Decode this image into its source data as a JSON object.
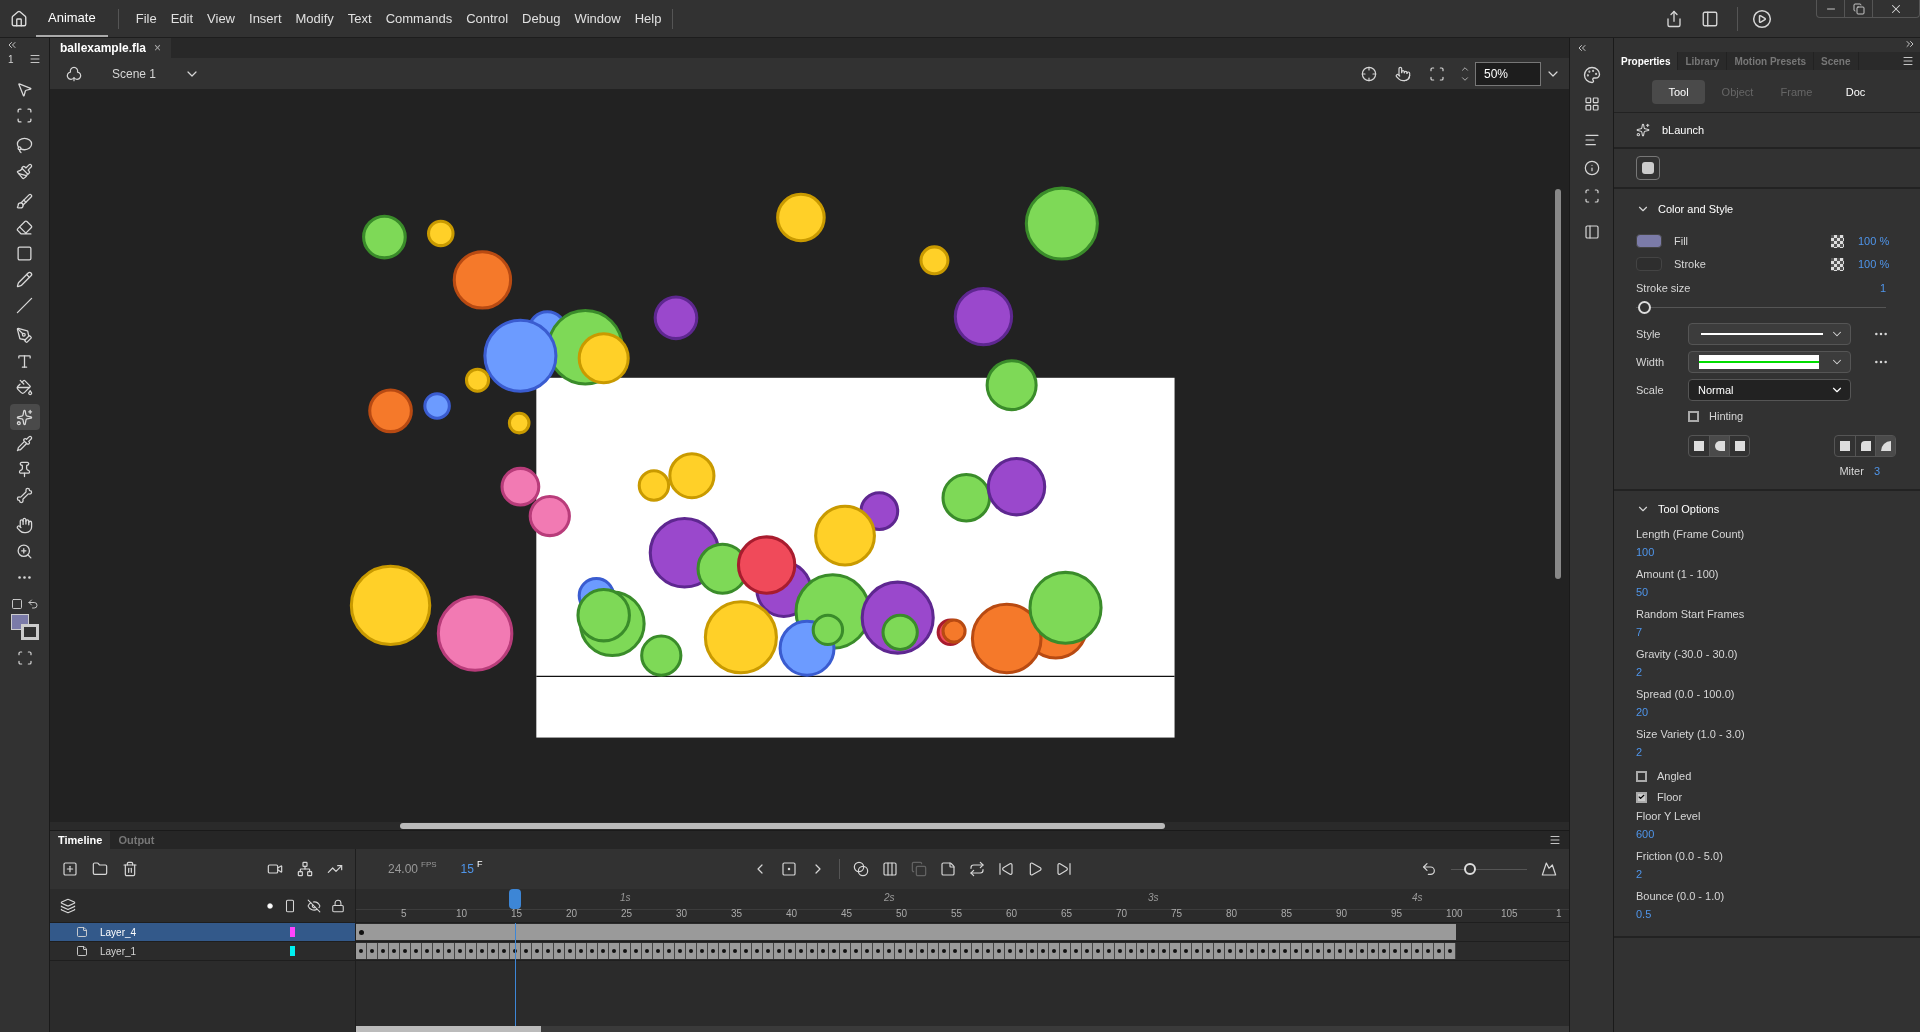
{
  "menu_bar": {
    "app_tab": "Animate",
    "menus": [
      "File",
      "Edit",
      "View",
      "Insert",
      "Modify",
      "Text",
      "Commands",
      "Control",
      "Debug",
      "Window",
      "Help"
    ]
  },
  "toolbar": {
    "workspace_number": "1",
    "tools": [
      {
        "kind": "select",
        "selected": false
      },
      {
        "kind": "subselect",
        "selected": false
      },
      {
        "kind": "lasso",
        "selected": false
      },
      {
        "kind": "paintbrush",
        "selected": false
      },
      {
        "kind": "brush",
        "selected": false
      },
      {
        "kind": "eraser",
        "selected": false
      },
      {
        "kind": "rectangle",
        "selected": false
      },
      {
        "kind": "pencil",
        "selected": false
      },
      {
        "kind": "line",
        "selected": false
      },
      {
        "kind": "pen",
        "selected": false
      },
      {
        "kind": "text",
        "selected": false
      },
      {
        "kind": "bucket",
        "selected": false
      },
      {
        "kind": "particle",
        "selected": true
      },
      {
        "kind": "eyedropper",
        "selected": false
      },
      {
        "kind": "pin",
        "selected": false
      },
      {
        "kind": "bone",
        "selected": false
      },
      {
        "kind": "hand",
        "selected": false
      },
      {
        "kind": "zoom",
        "selected": false
      },
      {
        "kind": "more",
        "selected": false
      }
    ]
  },
  "document": {
    "tab": "ballexample.fla",
    "close": "×",
    "scene": "Scene 1",
    "zoom": "50%"
  },
  "properties": {
    "tabs": [
      {
        "label": "Properties",
        "selected": true
      },
      {
        "label": "Library",
        "selected": false
      },
      {
        "label": "Motion Presets",
        "selected": false
      },
      {
        "label": "Scene",
        "selected": false
      }
    ],
    "subtabs": [
      {
        "label": "Tool",
        "selected": true,
        "disabled": false
      },
      {
        "label": "Object",
        "selected": false,
        "disabled": true
      },
      {
        "label": "Frame",
        "selected": false,
        "disabled": true
      },
      {
        "label": "Doc",
        "selected": false,
        "disabled": false
      }
    ],
    "tool_name": "bLaunch",
    "color_and_style": {
      "title": "Color and Style",
      "expanded": true,
      "swatches": [
        {
          "label": "Fill",
          "color": "#7b7ba8",
          "opacity": "100 %"
        },
        {
          "label": "Stroke",
          "color": "#2e2e2e",
          "opacity": "100 %"
        }
      ],
      "stroke_size": {
        "label": "Stroke size",
        "value": "1",
        "level": 0
      },
      "style_label": "Style",
      "width_label": "Width",
      "scale": {
        "label": "Scale",
        "value": "Normal"
      },
      "hinting": {
        "label": "Hinting",
        "checked": false
      },
      "caps": [
        {
          "selected": false
        },
        {
          "selected": true
        },
        {
          "selected": false
        }
      ],
      "joins": [
        {
          "selected": false
        },
        {
          "selected": false
        },
        {
          "selected": true
        }
      ],
      "miter": {
        "label": "Miter",
        "value": "3"
      }
    },
    "tool_options": {
      "title": "Tool Options",
      "expanded": true,
      "fields": [
        {
          "kind": "number",
          "label": "Length (Frame Count)",
          "value": "100"
        },
        {
          "kind": "number",
          "label": "Amount (1 - 100)",
          "value": "50"
        },
        {
          "kind": "number",
          "label": "Random Start Frames",
          "value": "7"
        },
        {
          "kind": "number",
          "label": "Gravity (-30.0 - 30.0)",
          "value": "2"
        },
        {
          "kind": "number",
          "label": "Spread (0.0 - 100.0)",
          "value": "20"
        },
        {
          "kind": "number",
          "label": "Size Variety (1.0 - 3.0)",
          "value": "2"
        },
        {
          "kind": "checkbox",
          "label": "Angled",
          "checked": false
        },
        {
          "kind": "checkbox",
          "label": "Floor",
          "checked": true
        },
        {
          "kind": "number",
          "label": "Floor Y Level",
          "value": "600"
        },
        {
          "kind": "number",
          "label": "Friction (0.0 - 5.0)",
          "value": "2"
        },
        {
          "kind": "number",
          "label": "Bounce (0.0 - 1.0)",
          "value": "0.5"
        }
      ]
    }
  },
  "timeline": {
    "tabs": [
      {
        "label": "Timeline",
        "selected": true
      },
      {
        "label": "Output",
        "selected": false
      }
    ],
    "fps": "24.00",
    "fps_unit": "FPS",
    "frame": "15",
    "frame_unit": "F",
    "zoom_slider": {
      "level": 0.25
    },
    "frame_labels": [
      "5",
      "10",
      "15",
      "20",
      "25",
      "30",
      "35",
      "40",
      "45",
      "50",
      "55",
      "60",
      "65",
      "70",
      "75",
      "80",
      "85",
      "90",
      "95",
      "100",
      "105",
      "1"
    ],
    "second_labels": [
      "1s",
      "2s",
      "3s",
      "4s"
    ],
    "layers": [
      {
        "name": "Layer_4",
        "selected": true,
        "color": "#ff44ff",
        "kind": "span"
      },
      {
        "name": "Layer_1",
        "selected": false,
        "color": "#00f0f0",
        "kind": "keyframes"
      }
    ]
  }
}
